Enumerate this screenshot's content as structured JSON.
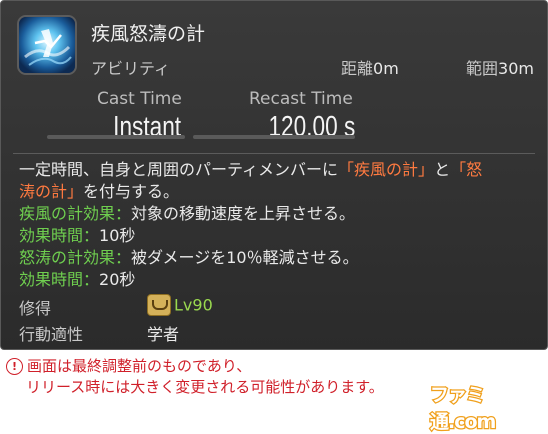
{
  "action": {
    "name": "疾風怒濤の計",
    "type": "アビリティ",
    "distance_label": "距離",
    "distance_value": "0m",
    "radius_label": "範囲",
    "radius_value": "30m"
  },
  "timing": {
    "cast_label": "Cast Time",
    "cast_value": "Instant",
    "recast_label": "Recast Time",
    "recast_value": "120.00 s"
  },
  "description": {
    "line1_pre": "一定時間、自身と周囲のパーティメンバーに",
    "line1_hl1": "「疾風の計」",
    "line1_mid": "と",
    "line1_hl2": "「怒",
    "line2_hl": "涛の計」",
    "line2_post": "を付与する。",
    "effect1_label": "疾風の計効果：",
    "effect1_text": "対象の移動速度を上昇させる。",
    "duration1_label": "効果時間：",
    "duration1_text": "10秒",
    "effect2_label": "怒涛の計効果：",
    "effect2_text": "被ダメージを10％軽減させる。",
    "duration2_label": "効果時間：",
    "duration2_text": "20秒"
  },
  "requirements": {
    "acquired_label": "修得",
    "acquired_value": "Lv90",
    "job_label": "行動適性",
    "job_value": "学者"
  },
  "notice": {
    "mark": "!",
    "line1": "画面は最終調整前のものであり、",
    "line2": "リリース時には大きく変更される可能性があります。"
  },
  "logo": {
    "text": "ファミ通.com"
  },
  "colors": {
    "highlight": "#ff7a40",
    "effect_label": "#6fcf4f",
    "level": "#9ad94f",
    "notice": "#d0202a",
    "logo_stroke": "#f0a01c"
  },
  "icons": {
    "action": "gale-wind-icon",
    "job": "scholar-job-icon"
  }
}
